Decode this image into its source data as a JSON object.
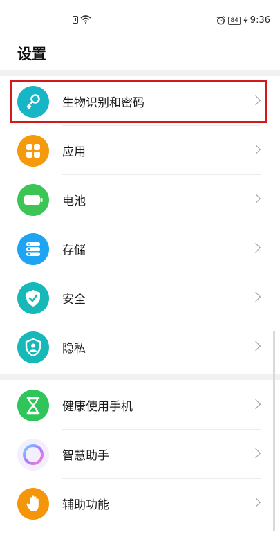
{
  "status": {
    "battery": "84",
    "time": "9:36"
  },
  "title": "设置",
  "group1": [
    {
      "label": "生物识别和密码",
      "icon": "key-icon",
      "color": "#17b6c6"
    },
    {
      "label": "应用",
      "icon": "apps-grid-icon",
      "color": "#f59a0c"
    },
    {
      "label": "电池",
      "icon": "battery-icon",
      "color": "#3cc454"
    },
    {
      "label": "存储",
      "icon": "storage-icon",
      "color": "#1da4f2"
    },
    {
      "label": "安全",
      "icon": "shield-check-icon",
      "color": "#16b8b8"
    },
    {
      "label": "隐私",
      "icon": "privacy-icon",
      "color": "#16b8b8"
    }
  ],
  "group2": [
    {
      "label": "健康使用手机",
      "icon": "hourglass-icon",
      "color": "#2ec55a"
    },
    {
      "label": "智慧助手",
      "icon": "assistant-ring-icon",
      "color": "#b59af0"
    },
    {
      "label": "辅助功能",
      "icon": "hand-icon",
      "color": "#f5950a"
    }
  ]
}
